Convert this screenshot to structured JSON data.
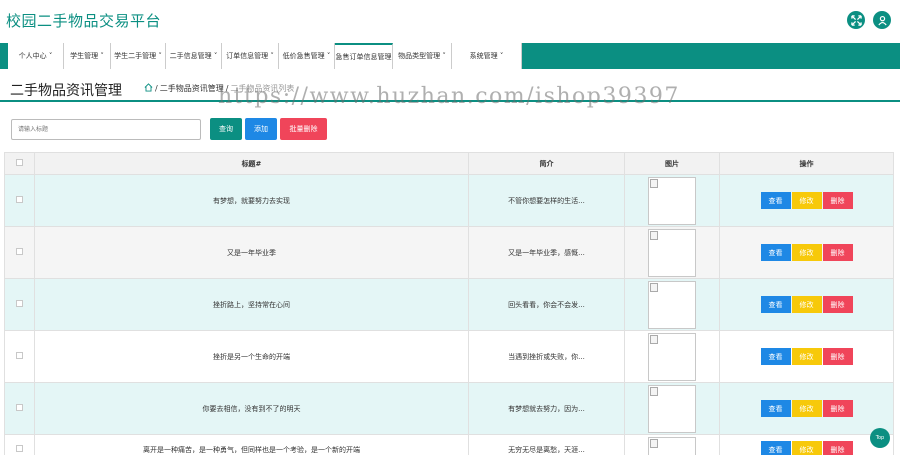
{
  "app": {
    "title": "校园二手物品交易平台",
    "icons": [
      "expand-icon",
      "user-icon"
    ]
  },
  "nav": {
    "items": [
      {
        "label": "个人中心 ˅",
        "width": 56
      },
      {
        "label": "学生管理 ˅",
        "width": 47
      },
      {
        "label": "学生二手管理 ˅",
        "width": 55
      },
      {
        "label": "二手信息管理 ˅",
        "width": 56
      },
      {
        "label": "订单信息管理 ˅",
        "width": 57
      },
      {
        "label": "低价急售管理 ˅",
        "width": 56
      },
      {
        "label": "急售订单信息管理",
        "width": 58
      },
      {
        "label": "物品类型管理 ˅",
        "width": 59
      },
      {
        "label": "系统管理 ˅",
        "width": 70
      }
    ],
    "active_index": 6
  },
  "page": {
    "title": "二手物品资讯管理",
    "breadcrumb": [
      "二手物品资讯管理",
      "二手物品资讯列表"
    ],
    "watermark": "https://www.huzhan.com/ishop39397"
  },
  "toolbar": {
    "search_placeholder": "请输入标题",
    "search_label": "查询",
    "add_label": "添加",
    "batch_delete_label": "批量删除"
  },
  "table": {
    "headers": [
      "标题#",
      "简介",
      "图片",
      "操作"
    ],
    "actions": {
      "view": "查看",
      "edit": "修改",
      "delete": "删除"
    },
    "rows": [
      {
        "title": "有梦想，就要努力去实现",
        "summary": "不管你想要怎样的生活..."
      },
      {
        "title": "又是一年毕业季",
        "summary": "又是一年毕业季，感慨..."
      },
      {
        "title": "挫折路上，坚持常在心间",
        "summary": "回头看看，你会不会发..."
      },
      {
        "title": "挫折是另一个生命的开端",
        "summary": "当遇到挫折或失败，你..."
      },
      {
        "title": "你要去相信，没有到不了的明天",
        "summary": "有梦想就去努力，因为..."
      },
      {
        "title": "离开是一种痛苦，是一种勇气，但同样也是一个考验，是一个新的开端",
        "summary": "无穷无尽是离愁，天涯..."
      }
    ]
  },
  "fab": {
    "top_label": "Top"
  },
  "colors": {
    "accent": "#0b8f82",
    "blue": "#1e88e5",
    "yellow": "#f7c90a",
    "red": "#f0455a",
    "row_alt": "#e4f6f6"
  }
}
